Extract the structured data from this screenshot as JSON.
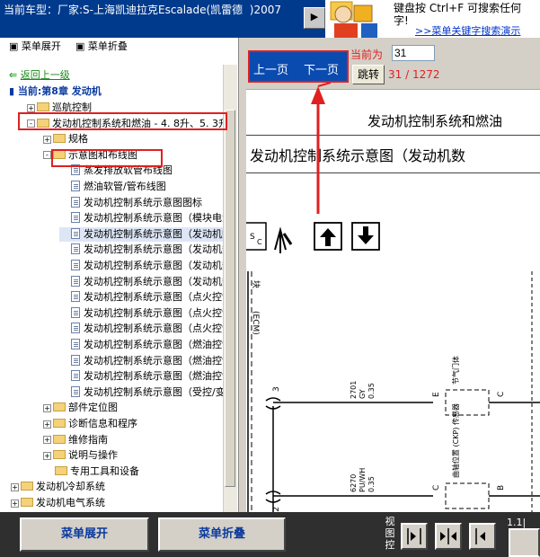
{
  "header": {
    "vehicle": "当前车型：厂家:S-上海凯迪拉克Escalade(凯雷德  )2007",
    "ad_line1": "键盘按  Ctrl+F  可搜索任何",
    "ad_line2": "字!",
    "ad_link": ">>菜单关键字搜索演示"
  },
  "tree_toolbar": {
    "expand": "菜单展开",
    "collapse": "菜单折叠"
  },
  "tree": {
    "back": "返回上一级",
    "current": "当前:第8章 发动机",
    "items": [
      {
        "label": "巡航控制",
        "type": "folder",
        "expander": "+"
      },
      {
        "label": "发动机控制系统和燃油 - 4. 8升、5. 3升、",
        "type": "folder",
        "expander": "-"
      },
      {
        "label": "规格",
        "type": "folder",
        "expander": "+"
      },
      {
        "label": "示意图和布线图",
        "type": "folder",
        "expander": "-"
      },
      {
        "label": "蒸发排放软管布线图",
        "type": "doc"
      },
      {
        "label": "燃油软管/管布线图",
        "type": "doc"
      },
      {
        "label": "发动机控制系统示意图图标",
        "type": "doc"
      },
      {
        "label": "发动机控制系统示意图（模块电源",
        "type": "doc"
      },
      {
        "label": "发动机控制系统示意图（发动机数",
        "type": "doc",
        "selected": true
      },
      {
        "label": "发动机控制系统示意图（发动机数",
        "type": "doc"
      },
      {
        "label": "发动机控制系统示意图（发动机数",
        "type": "doc"
      },
      {
        "label": "发动机控制系统示意图（发动机数",
        "type": "doc"
      },
      {
        "label": "发动机控制系统示意图（点火控制",
        "type": "doc"
      },
      {
        "label": "发动机控制系统示意图（点火控制",
        "type": "doc"
      },
      {
        "label": "发动机控制系统示意图（点火控制",
        "type": "doc"
      },
      {
        "label": "发动机控制系统示意图（燃油控制",
        "type": "doc"
      },
      {
        "label": "发动机控制系统示意图（燃油控制",
        "type": "doc"
      },
      {
        "label": "发动机控制系统示意图（燃油控制",
        "type": "doc"
      },
      {
        "label": "发动机控制系统示意图（受控/变量",
        "type": "doc"
      },
      {
        "label": "部件定位图",
        "type": "folder",
        "expander": "+"
      },
      {
        "label": "诊断信息和程序",
        "type": "folder",
        "expander": "+"
      },
      {
        "label": "维修指南",
        "type": "folder",
        "expander": "+"
      },
      {
        "label": "说明与操作",
        "type": "folder",
        "expander": "+"
      },
      {
        "label": "专用工具和设备",
        "type": "folder"
      },
      {
        "label": "发动机冷却系统",
        "type": "folder",
        "expander": "+"
      },
      {
        "label": "发动机电气系统",
        "type": "folder",
        "expander": "+"
      }
    ]
  },
  "pager": {
    "prev": "上一页",
    "next": "下一页",
    "current_label": "当前为",
    "current_page": "31",
    "jump": "跳转",
    "page_count": "31 / 1272"
  },
  "document": {
    "title": "发动机控制系统和燃油",
    "subtitle": "发动机控制系统示意图（发动机数",
    "wire1": {
      "num": "2701",
      "color": "GY",
      "size": "0.35",
      "pin": "3",
      "conn": "E",
      "conn2": "C",
      "label": "节气门体"
    },
    "wire2": {
      "num": "6270",
      "color": "PU/WH",
      "size": "0.35",
      "pin": "C2",
      "conn": "C",
      "conn2": "B",
      "label": "曲轴位置 (CKP) 传感器"
    },
    "side_label": "(ECM)",
    "side_label2": "块"
  },
  "bottom": {
    "expand": "菜单展开",
    "collapse": "菜单折叠",
    "view_ctl": "视图控",
    "zoom": "1.1|"
  },
  "colors": {
    "accent": "#0a4bb0",
    "highlight": "#e02020"
  }
}
